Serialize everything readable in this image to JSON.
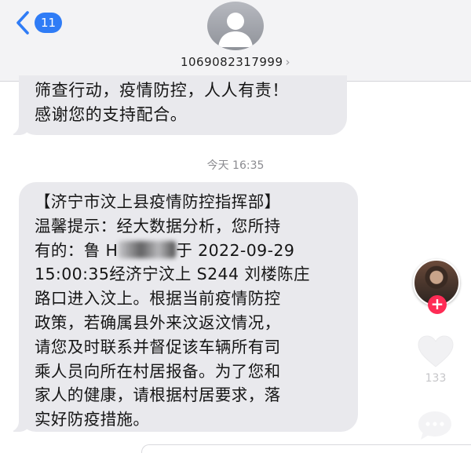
{
  "header": {
    "back_badge": "11",
    "sender_number": "1069082317999",
    "sender_arrow": "›"
  },
  "messages": [
    {
      "text": "筛查行动，疫情防控，人人有责！\n感谢您的支持配合。"
    },
    {
      "text_before": "【济宁市汶上县疫情防控指挥部】\n温馨提示：经大数据分析，您所持\n有的：鲁 H",
      "text_after": "于 2022-09-29\n15:00:35经济宁汶上 S244 刘楼陈庄\n路口进入汶上。根据当前疫情防控\n政策，若确属县外来汶返汶情况，\n请您及时联系并督促该车辆所有司\n乘人员向所在村居报备。为了您和\n家人的健康，请根据村居要求，落\n实好防疫措施。"
    }
  ],
  "timestamp": "今天 16:35",
  "overlay": {
    "follow_plus": "+",
    "like_count": "133"
  },
  "colors": {
    "accent": "#2f7cf6",
    "bubble": "#e9e9ed",
    "follow": "#fe2c55"
  },
  "icons": {
    "back": "chevron-left-icon",
    "contact": "contact-avatar-icon",
    "like": "heart-icon",
    "comment": "comment-icon"
  }
}
